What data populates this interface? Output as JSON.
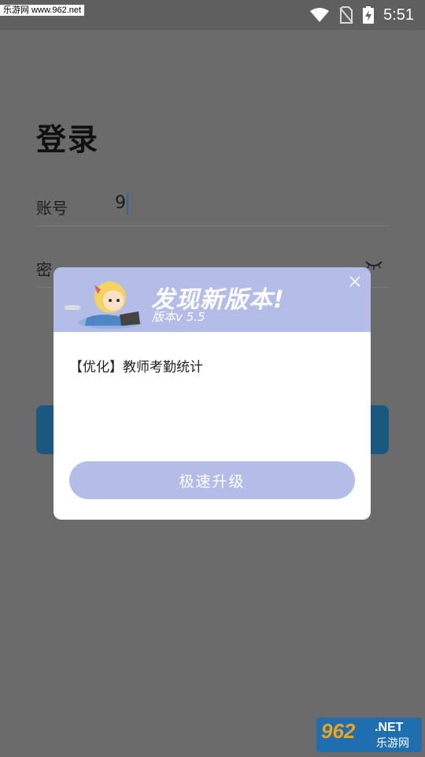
{
  "status_bar": {
    "watermark": "乐游网 www.962.net",
    "time": "5:51",
    "icons": [
      "wifi-icon",
      "no-sim-icon",
      "battery-charging-icon"
    ]
  },
  "login": {
    "title": "登录",
    "account_label": "账号",
    "account_value": "9",
    "password_label": "密",
    "password_toggle_icon": "eye-closed-icon"
  },
  "dialog": {
    "title": "发现新版本!",
    "version": "版本v 5.5",
    "body": "【优化】教师考勤统计",
    "button": "极速升级",
    "close_icon": "close-icon",
    "header_color": "#b3bde8",
    "button_color": "#b3bde8"
  },
  "footer_logo": {
    "number": "962",
    "suffix": ".NET",
    "chinese": "乐游网"
  }
}
